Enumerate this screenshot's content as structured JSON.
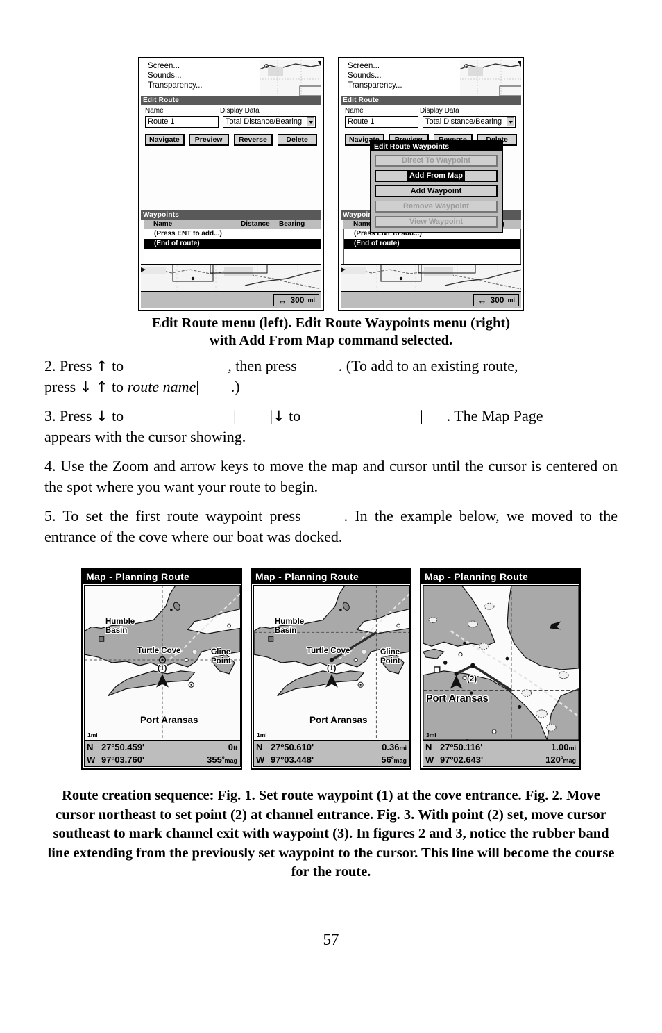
{
  "page": {
    "number": "57"
  },
  "figure1": {
    "caption_line1": "Edit Route menu (left). Edit Route Waypoints menu (right)",
    "caption_line2": "with Add From Map command selected.",
    "left_unit": {
      "menu_items": [
        "Screen...",
        "Sounds...",
        "Transparency..."
      ],
      "panel_title": "Edit Route",
      "label_name": "Name",
      "label_display_data": "Display Data",
      "value_name": "Route 1",
      "value_display_data": "Total Distance/Bearing",
      "buttons": [
        "Navigate",
        "Preview",
        "Reverse",
        "Delete"
      ],
      "waypoints_title": "Waypoints",
      "waypoints_columns": [
        "Name",
        "Distance",
        "Bearing"
      ],
      "waypoint_rows": [
        "(Press ENT to add...)",
        "(End of route)"
      ],
      "selected_row": "(End of route)",
      "scale_value": "300",
      "scale_unit": "mi"
    },
    "right_unit": {
      "menu_items": [
        "Screen...",
        "Sounds...",
        "Transparency..."
      ],
      "panel_title": "Edit Route",
      "label_name": "Name",
      "label_display_data": "Display Data",
      "value_name": "Route 1",
      "value_display_data": "Total Distance/Bearing",
      "buttons": [
        "Navigate",
        "Preview",
        "Reverse",
        "Delete"
      ],
      "waypoints_title": "Waypoints",
      "popup": {
        "title": "Edit Route Waypoints",
        "items": [
          {
            "label": "Direct To Waypoint",
            "state": "disabled"
          },
          {
            "label": "Add From Map",
            "state": "selected"
          },
          {
            "label": "Add Waypoint",
            "state": "enabled"
          },
          {
            "label": "Remove Waypoint",
            "state": "disabled"
          },
          {
            "label": "View Waypoint",
            "state": "disabled"
          }
        ]
      },
      "scale_value": "300",
      "scale_unit": "mi"
    }
  },
  "steps": {
    "step2": {
      "a": "2. Press ",
      "up": "↑",
      "b": " to",
      "c": ", then press",
      "d": ". (To add to an existing route,",
      "e": "press ",
      "down": "↓",
      "f": " to ",
      "route_name": "route name",
      "pipe": "|",
      "g": ".)"
    },
    "step3": {
      "a": "3. Press ",
      "down": "↓",
      "b": " to",
      "c": "to",
      "d": ". The Map Page",
      "e": "appears with the cursor showing."
    },
    "step4": "4. Use the Zoom and arrow keys to move the map and cursor until the cursor is centered on the spot where you want your route to begin.",
    "step5": {
      "a": "5. To set the first route waypoint press",
      "b": ". In the example below, we moved to the entrance of the cove where our boat was docked."
    }
  },
  "figure2": {
    "caption": "Route creation sequence: Fig. 1. Set route waypoint (1) at the cove entrance. Fig. 2. Move cursor northeast to set point (2) at channel entrance. Fig. 3. With point (2) set, move cursor southeast to mark channel exit with waypoint (3). In figures 2 and 3, notice the rubber band line extending from the previously set waypoint to the cursor. This line will become the course for the route.",
    "panels": [
      {
        "title": "Map - Planning Route",
        "scale": "1mi",
        "labels": [
          "Humble Basin",
          "Turtle Cove",
          "Cline Point",
          "Port Aransas",
          "(1)"
        ],
        "lat_hem": "N",
        "lat": "27º50.459'",
        "lon_hem": "W",
        "lon": "97º03.760'",
        "dist": "0",
        "dist_unit": "ft",
        "bearing": "355",
        "bearing_unit": "mag"
      },
      {
        "title": "Map - Planning Route",
        "scale": "1mi",
        "labels": [
          "Humble Basin",
          "Turtle Cove",
          "Cline Point",
          "Port Aransas",
          "(1)"
        ],
        "lat_hem": "N",
        "lat": "27º50.610'",
        "lon_hem": "W",
        "lon": "97º03.448'",
        "dist": "0.36",
        "dist_unit": "mi",
        "bearing": "56",
        "bearing_unit": "mag"
      },
      {
        "title": "Map - Planning Route",
        "scale": "3mi",
        "labels": [
          "Port Aransas",
          "(2)"
        ],
        "lat_hem": "N",
        "lat": "27º50.116'",
        "lon_hem": "W",
        "lon": "97º02.643'",
        "dist": "1.00",
        "dist_unit": "mi",
        "bearing": "120",
        "bearing_unit": "mag"
      }
    ]
  }
}
